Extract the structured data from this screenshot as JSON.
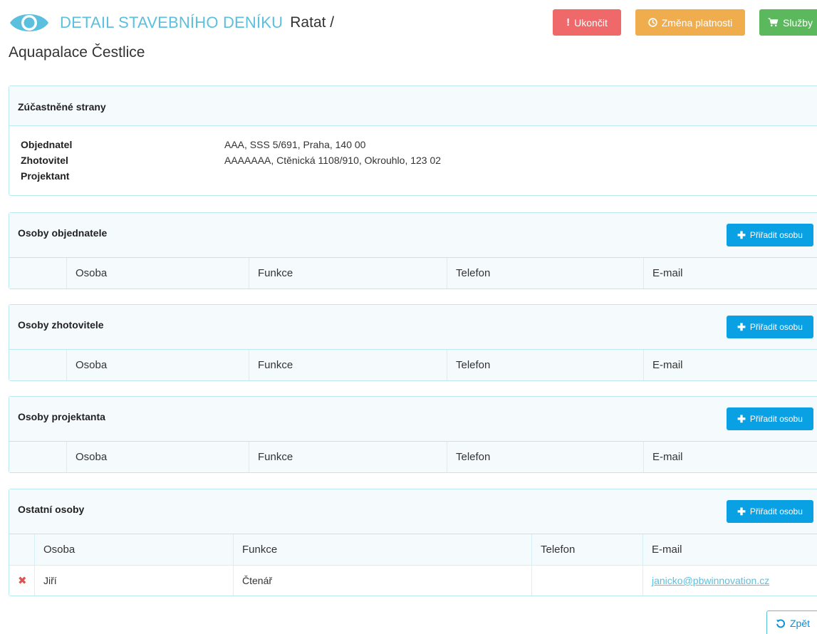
{
  "header": {
    "title": "DETAIL STAVEBNÍHO DENÍKU",
    "path_first": "Ratat /",
    "path_second": "Aquapalace Čestlice",
    "buttons": {
      "end": "Ukončit",
      "validity": "Změna platnosti",
      "services": "Služby"
    }
  },
  "parties": {
    "title": "Zúčastněné strany",
    "items": [
      {
        "label": "Objednatel",
        "value": "AAA, SSS 5/691, Praha, 140 00"
      },
      {
        "label": "Zhotovitel",
        "value": "AAAAAAA, Ctěnická 1108/910, Okrouhlo, 123 02"
      },
      {
        "label": "Projektant",
        "value": ""
      }
    ]
  },
  "columns": {
    "person": "Osoba",
    "function": "Funkce",
    "phone": "Telefon",
    "email": "E-mail"
  },
  "assign_label": "Přiřadit osobu",
  "sections": {
    "client": {
      "title": "Osoby objednatele"
    },
    "contractor": {
      "title": "Osoby zhotovitele"
    },
    "designer": {
      "title": "Osoby projektanta"
    },
    "other": {
      "title": "Ostatní osoby",
      "rows": [
        {
          "person": "Jiří",
          "function": "Čtenář",
          "phone": "",
          "email": "janicko@pbwinnovation.cz"
        }
      ]
    }
  },
  "back_label": "Zpět",
  "colors": {
    "accent": "#5bc0de",
    "primary_button": "#0aa0e4",
    "danger": "#f0696a",
    "warning": "#f0ad4e",
    "success": "#5cb85c"
  }
}
